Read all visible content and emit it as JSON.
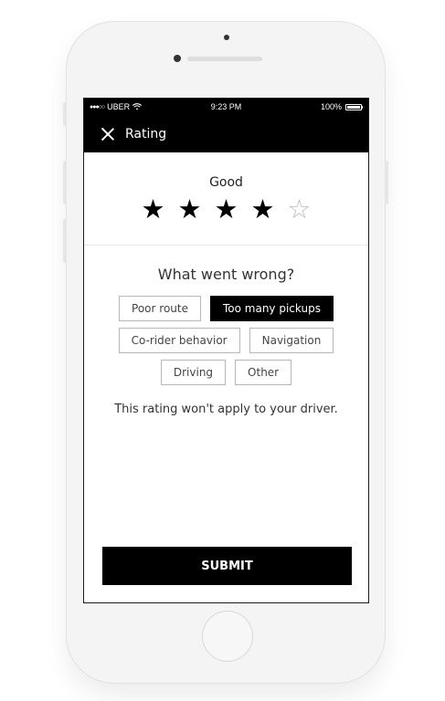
{
  "status_bar": {
    "carrier": "UBER",
    "time": "9:23 PM",
    "battery": "100%"
  },
  "header": {
    "title": "Rating",
    "close_icon": "close-icon"
  },
  "rating": {
    "label": "Good",
    "stars_filled": 4,
    "stars_total": 5
  },
  "question": "What went wrong?",
  "tags": [
    {
      "label": "Poor route",
      "selected": false
    },
    {
      "label": "Too many pickups",
      "selected": true
    },
    {
      "label": "Co-rider behavior",
      "selected": false
    },
    {
      "label": "Navigation",
      "selected": false
    },
    {
      "label": "Driving",
      "selected": false
    },
    {
      "label": "Other",
      "selected": false
    }
  ],
  "note": "This rating won't apply to your driver.",
  "submit_label": "SUBMIT",
  "colors": {
    "primary": "#000000",
    "background": "#ffffff",
    "border": "#b8b8b8"
  }
}
